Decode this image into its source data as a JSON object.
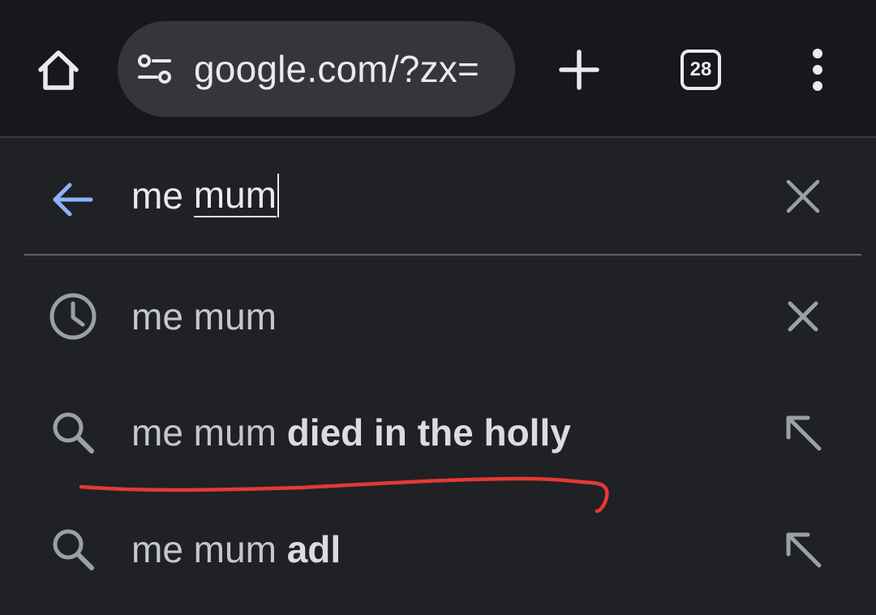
{
  "toolbar": {
    "url": "google.com/?zx=",
    "tab_count": "28",
    "icons": {
      "home": "home-icon",
      "site_settings": "tune-icon",
      "new_tab": "plus-icon",
      "tab_switcher": "tab-switcher-icon",
      "menu": "more-vert-icon"
    }
  },
  "search": {
    "prefix": "me ",
    "composing": "mum",
    "icons": {
      "back": "arrow-back-icon",
      "clear": "close-icon"
    },
    "accent_color": "#8ab4f8"
  },
  "suggestions": [
    {
      "type": "history",
      "icon": "history-icon",
      "action_icon": "close-icon",
      "plain": "me mum",
      "bold": ""
    },
    {
      "type": "search",
      "icon": "search-icon",
      "action_icon": "arrow-up-left-icon",
      "plain": "me mum ",
      "bold": "died in the holly"
    },
    {
      "type": "search",
      "icon": "search-icon",
      "action_icon": "arrow-up-left-icon",
      "plain": "me mum ",
      "bold": "adl"
    }
  ],
  "annotation": {
    "color": "#e53935",
    "type": "hand-drawn underline"
  },
  "colors": {
    "background": "#202124",
    "toolbar": "#17181b",
    "omnibox": "#35363a",
    "text": "#e8eaed",
    "icon_muted": "#9aa0a6"
  }
}
